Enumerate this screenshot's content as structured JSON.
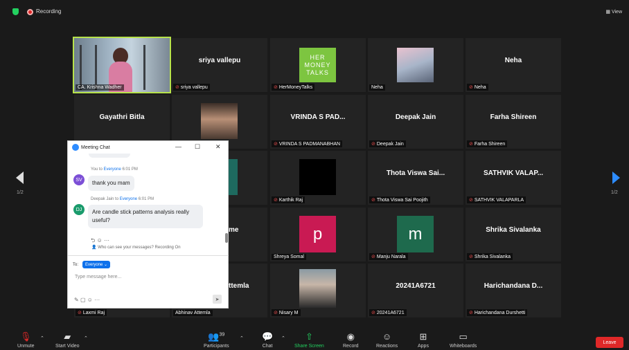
{
  "topbar": {
    "recording_label": "Recording",
    "view_label": "View"
  },
  "tiles": [
    {
      "name": "",
      "label": "CA. Krishna Wadher",
      "muted": false,
      "active": true
    },
    {
      "name": "sriya vallepu",
      "label": "sriya vallepu",
      "muted": true
    },
    {
      "name": "",
      "label": "HerMoneyTalks",
      "muted": true,
      "logo_lines": [
        "HER",
        "MONEY",
        "TALKS"
      ]
    },
    {
      "name": "",
      "label": "Neha",
      "muted": false
    },
    {
      "name": "Neha",
      "label": "Neha",
      "muted": true
    },
    {
      "name": "Gayathri Bitla",
      "label": "",
      "muted": false
    },
    {
      "name": "",
      "label": "",
      "muted": false
    },
    {
      "name": "VRINDA S PAD...",
      "label": "VRINDA S PADMANABHAN",
      "muted": true
    },
    {
      "name": "Deepak Jain",
      "label": "Deepak Jain",
      "muted": true
    },
    {
      "name": "Farha Shireen",
      "label": "Farha Shireen",
      "muted": true
    },
    {
      "name": "",
      "label": "Karthik Raj",
      "muted": true
    },
    {
      "name": "Thota Viswa Sai...",
      "label": "Thota Viswa Sai Poojith",
      "muted": true
    },
    {
      "name": "SATHVIK VALAP...",
      "label": "SATHVIK VALAPARLA",
      "muted": true
    },
    {
      "name": "me",
      "label": "",
      "muted": false
    },
    {
      "name": "",
      "label": "Shreya Somal",
      "muted": false,
      "letter": "p"
    },
    {
      "name": "",
      "label": "Manju Narala",
      "muted": true,
      "letter": "m"
    },
    {
      "name": "Shrika Sivalanka",
      "label": "Shrika Sivalanka",
      "muted": true
    },
    {
      "name": "Laxmi Raj",
      "label": "Laxmi Raj",
      "muted": true
    },
    {
      "name": "ttemla",
      "label": "Abhinav Attemla",
      "muted": false
    },
    {
      "name": "",
      "label": "Nisary M",
      "muted": true
    },
    {
      "name": "20241A6721",
      "label": "20241A6721",
      "muted": true
    },
    {
      "name": "Harichandana D...",
      "label": "Harichandana Durshetti",
      "muted": true
    }
  ],
  "pager": {
    "left": "1/2",
    "right": "1/2"
  },
  "chat": {
    "title": "Meeting Chat",
    "messages": [
      {
        "avatar": "SV",
        "avatar_color": "#7c4fd6",
        "meta_prefix": "You to ",
        "meta_to": "Everyone",
        "time": "6:01 PM",
        "text": "thank you mam"
      },
      {
        "avatar": "DJ",
        "avatar_color": "#1a9b6c",
        "meta_prefix": "Deepak Jain to ",
        "meta_to": "Everyone",
        "time": "6:01 PM",
        "text": "Are candle stick patterns analysis really useful?"
      }
    ],
    "who_can_see": "Who can see your messages? Recording On",
    "to_label": "To:",
    "recipient": "Everyone",
    "placeholder": "Type message here..."
  },
  "bottombar": {
    "unmute": "Unmute",
    "start_video": "Start Video",
    "participants": "Participants",
    "participants_count": "39",
    "chat": "Chat",
    "share_screen": "Share Screen",
    "record": "Record",
    "reactions": "Reactions",
    "apps": "Apps",
    "whiteboards": "Whiteboards",
    "leave": "Leave"
  }
}
